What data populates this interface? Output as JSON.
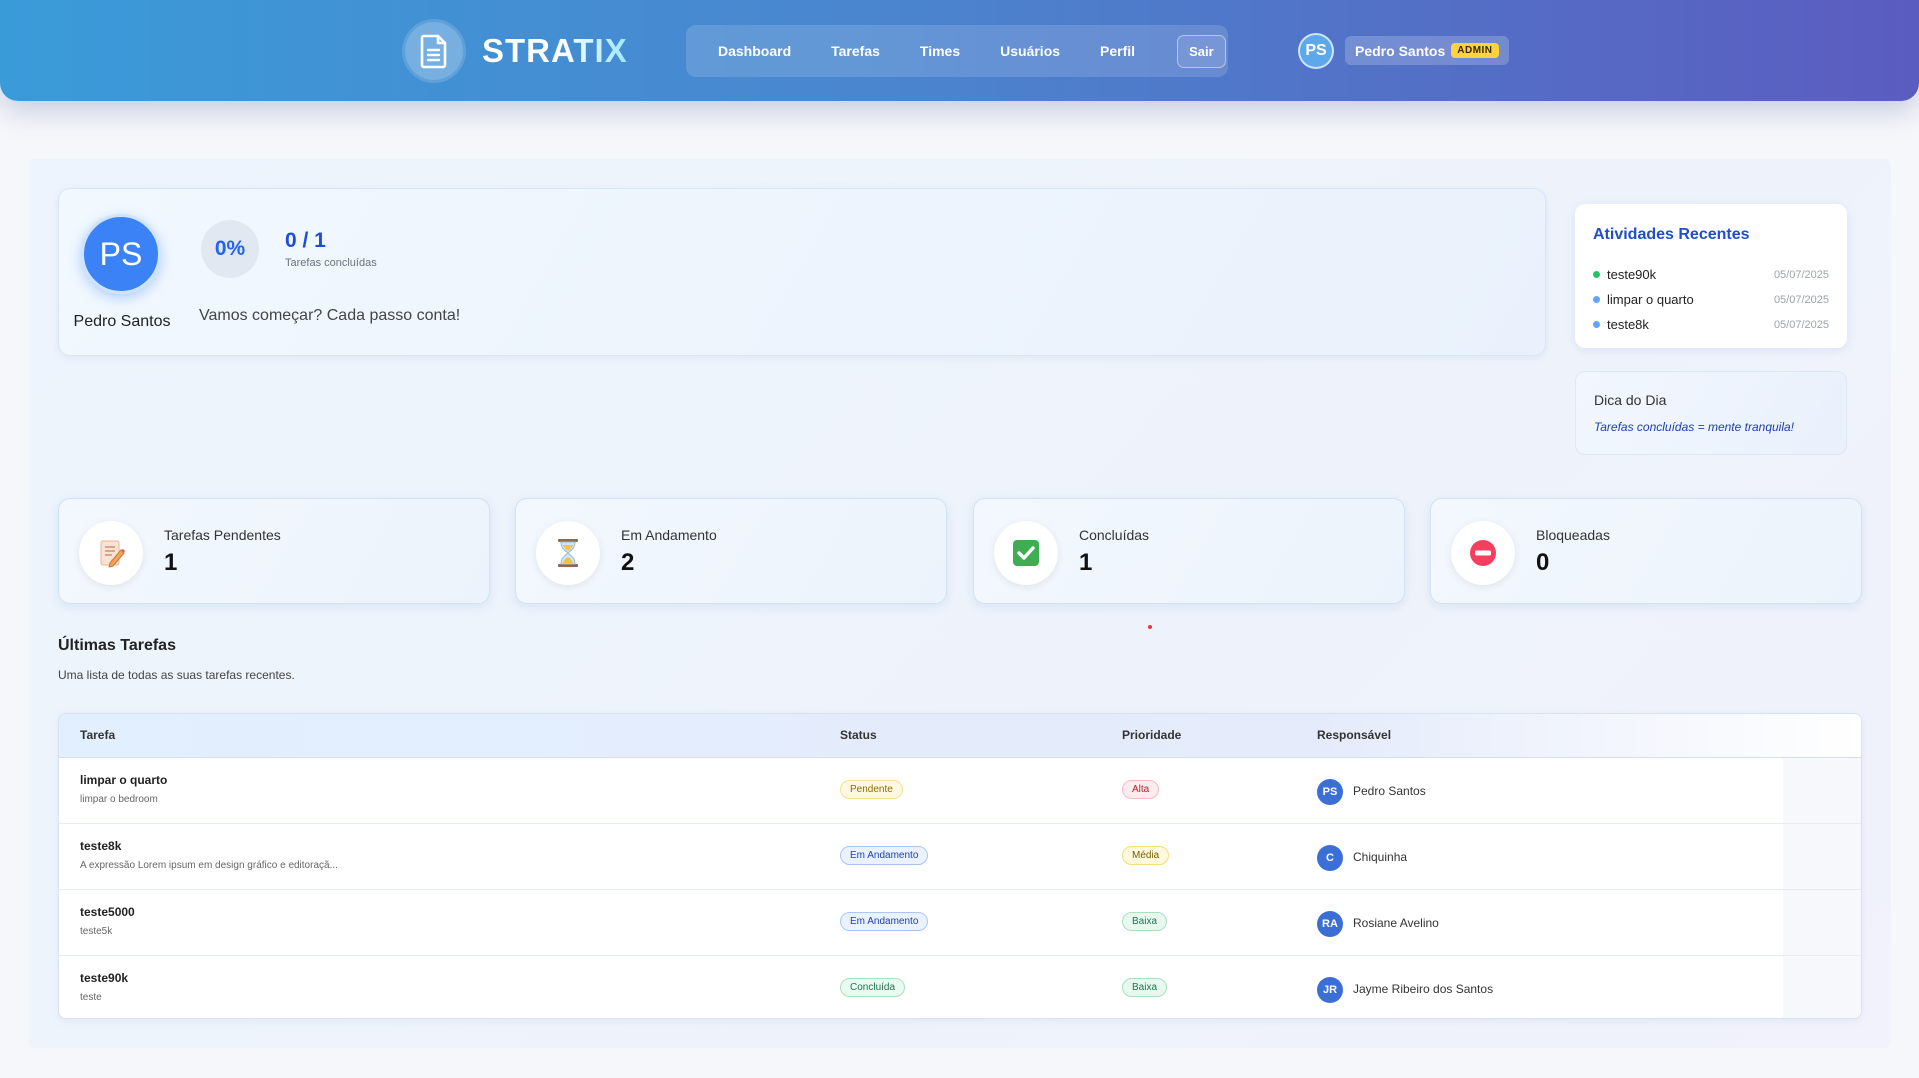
{
  "header": {
    "logo": "STRATIX",
    "nav": [
      "Dashboard",
      "Tarefas",
      "Times",
      "Usuários",
      "Perfil"
    ],
    "logout": "Sair",
    "user_initials": "PS",
    "user_name": "Pedro Santos",
    "role_badge": "ADMIN"
  },
  "profile": {
    "initials": "PS",
    "name": "Pedro Santos",
    "progress_percent": "0%",
    "tasks_ratio": "0 / 1",
    "tasks_ratio_label": "Tarefas concluídas",
    "motivation": "Vamos começar? Cada passo conta!"
  },
  "activities": {
    "title": "Atividades Recentes",
    "items": [
      {
        "name": "teste90k",
        "date": "05/07/2025",
        "dot_color": "#22c55e"
      },
      {
        "name": "limpar o quarto",
        "date": "05/07/2025",
        "dot_color": "#60a5fa"
      },
      {
        "name": "teste8k",
        "date": "05/07/2025",
        "dot_color": "#60a5fa"
      }
    ]
  },
  "tip": {
    "title": "Dica do Dia",
    "text": "Tarefas concluídas = mente tranquila!"
  },
  "stats": [
    {
      "label": "Tarefas Pendentes",
      "value": "1",
      "icon": "memo-icon"
    },
    {
      "label": "Em Andamento",
      "value": "2",
      "icon": "hourglass-icon"
    },
    {
      "label": "Concluídas",
      "value": "1",
      "icon": "check-icon"
    },
    {
      "label": "Bloqueadas",
      "value": "0",
      "icon": "no-entry-icon"
    }
  ],
  "recent": {
    "title": "Últimas Tarefas",
    "subtitle": "Uma lista de todas as suas tarefas recentes.",
    "columns": [
      "Tarefa",
      "Status",
      "Prioridade",
      "Responsável"
    ],
    "rows": [
      {
        "title": "limpar o quarto",
        "desc": "limpar o bedroom",
        "status": "Pendente",
        "priority": "Alta",
        "initials": "PS",
        "assignee": "Pedro Santos"
      },
      {
        "title": "teste8k",
        "desc": "A expressão Lorem ipsum em design gráfico e editoraçã...",
        "status": "Em Andamento",
        "priority": "Média",
        "initials": "C",
        "assignee": "Chiquinha"
      },
      {
        "title": "teste5000",
        "desc": "teste5k",
        "status": "Em Andamento",
        "priority": "Baixa",
        "initials": "RA",
        "assignee": "Rosiane Avelino"
      },
      {
        "title": "teste90k",
        "desc": "teste",
        "status": "Concluída",
        "priority": "Baixa",
        "initials": "JR",
        "assignee": "Jayme Ribeiro dos Santos"
      }
    ]
  },
  "colors": {
    "status_pendente": "#fef9e0",
    "status_andamento": "#eaf2ff",
    "status_concluida": "#e9faf0",
    "priority_alta": "#fdecee",
    "priority_media": "#fef8dc",
    "priority_baixa": "#e8f8ef"
  }
}
